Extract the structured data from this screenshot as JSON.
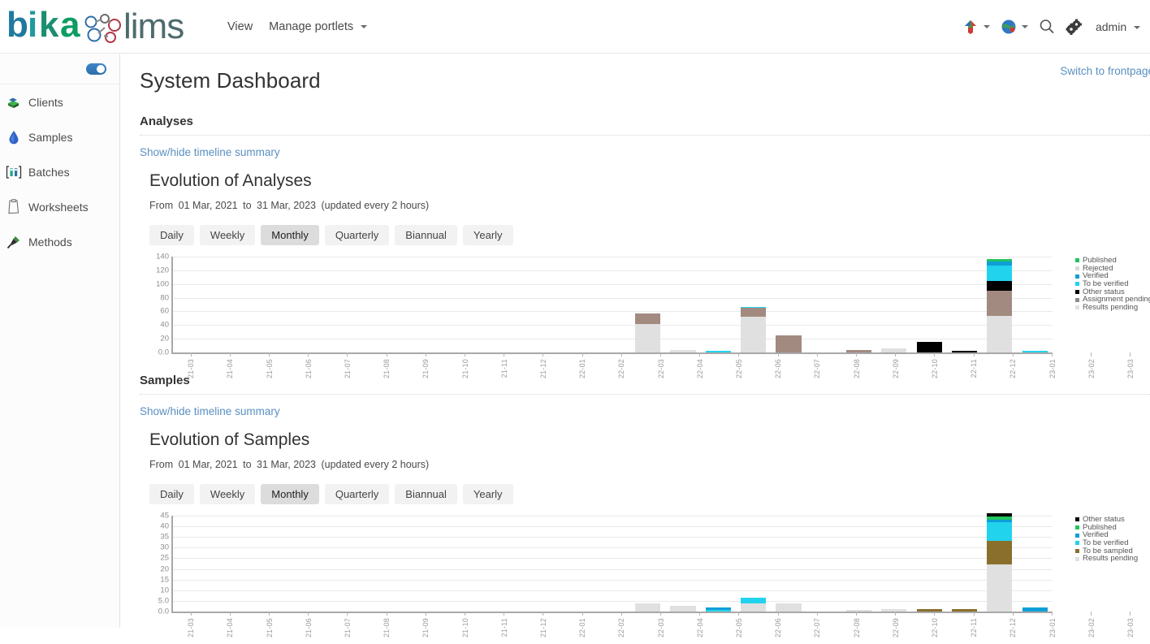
{
  "brand": {
    "name_part1": "bika",
    "name_part2": "lims"
  },
  "topnav": {
    "items": [
      {
        "label": "View",
        "has_caret": false
      },
      {
        "label": "Manage portlets",
        "has_caret": true
      }
    ],
    "icons": [
      "plone-logo-icon",
      "globe-language-icon",
      "search-icon",
      "gears-settings-icon"
    ],
    "user": "admin"
  },
  "sidebar": {
    "toggle_state": "on",
    "items": [
      {
        "label": "Clients",
        "icon": "clients-stack-icon"
      },
      {
        "label": "Samples",
        "icon": "water-drop-icon"
      },
      {
        "label": "Batches",
        "icon": "batches-bracket-icon"
      },
      {
        "label": "Worksheets",
        "icon": "clipboard-icon"
      },
      {
        "label": "Methods",
        "icon": "pin-method-icon"
      }
    ]
  },
  "page": {
    "title": "System Dashboard",
    "switch_link": "Switch to frontpage"
  },
  "sections": [
    {
      "heading": "Analyses",
      "showhide_label": "Show/hide timeline summary",
      "chart_title": "Evolution of Analyses",
      "range_prefix": "From",
      "range_from": "01 Mar, 2021",
      "range_mid": "to",
      "range_to": "31 Mar, 2023",
      "range_suffix": "(updated every 2 hours)",
      "periods": [
        "Daily",
        "Weekly",
        "Monthly",
        "Quarterly",
        "Biannual",
        "Yearly"
      ],
      "active_period": "Monthly"
    },
    {
      "heading": "Samples",
      "showhide_label": "Show/hide timeline summary",
      "chart_title": "Evolution of Samples",
      "range_prefix": "From",
      "range_from": "01 Mar, 2021",
      "range_mid": "to",
      "range_to": "31 Mar, 2023",
      "range_suffix": "(updated every 2 hours)",
      "periods": [
        "Daily",
        "Weekly",
        "Monthly",
        "Quarterly",
        "Biannual",
        "Yearly"
      ],
      "active_period": "Monthly"
    }
  ],
  "chart_data": [
    {
      "type": "bar",
      "stacked": true,
      "title": "Evolution of Analyses",
      "xlabel": "",
      "ylabel": "",
      "ylim": [
        0,
        140
      ],
      "yticks": [
        "140",
        "120",
        "100",
        "80",
        "60",
        "40",
        "20",
        "0.0"
      ],
      "ytick_values": [
        140,
        120,
        100,
        80,
        60,
        40,
        20,
        0
      ],
      "grid": true,
      "legend_position": "right",
      "categories": [
        "21-03",
        "21-04",
        "21-05",
        "21-06",
        "21-07",
        "21-08",
        "21-09",
        "21-10",
        "21-11",
        "21-12",
        "22-01",
        "22-02",
        "22-03",
        "22-04",
        "22-05",
        "22-06",
        "22-07",
        "22-08",
        "22-09",
        "22-10",
        "22-11",
        "22-12",
        "23-01",
        "23-02",
        "23-03"
      ],
      "series": [
        {
          "name": "Results pending",
          "color": "#e0e0e0",
          "values": [
            0,
            0,
            0,
            0,
            0,
            0,
            0,
            0,
            0,
            0,
            0,
            0,
            0,
            42,
            3,
            0,
            52,
            0,
            0,
            0,
            6,
            0,
            0,
            53,
            0
          ]
        },
        {
          "name": "Assignment pending",
          "color": "#a28a80",
          "values": [
            0,
            0,
            0,
            0,
            0,
            0,
            0,
            0,
            0,
            0,
            0,
            0,
            0,
            15,
            0,
            0,
            13,
            25,
            0,
            3,
            0,
            0,
            0,
            37,
            0
          ]
        },
        {
          "name": "Other status",
          "color": "#000000",
          "values": [
            0,
            0,
            0,
            0,
            0,
            0,
            0,
            0,
            0,
            0,
            0,
            0,
            0,
            0,
            0,
            0,
            0,
            0,
            0,
            0,
            0,
            15,
            2,
            15,
            0
          ]
        },
        {
          "name": "To be verified",
          "color": "#22d3ee",
          "values": [
            0,
            0,
            0,
            0,
            0,
            0,
            0,
            0,
            0,
            0,
            0,
            0,
            0,
            0,
            0,
            2,
            2,
            0,
            0,
            0,
            0,
            0,
            0,
            22,
            2
          ]
        },
        {
          "name": "Verified",
          "color": "#0e9fd8",
          "values": [
            0,
            0,
            0,
            0,
            0,
            0,
            0,
            0,
            0,
            0,
            0,
            0,
            0,
            0,
            0,
            0,
            0,
            0,
            0,
            0,
            0,
            0,
            0,
            6,
            0
          ]
        },
        {
          "name": "Published",
          "color": "#22c55e",
          "values": [
            0,
            0,
            0,
            0,
            0,
            0,
            0,
            0,
            0,
            0,
            0,
            0,
            0,
            0,
            0,
            0,
            0,
            0,
            0,
            0,
            0,
            0,
            0,
            3,
            0
          ]
        }
      ],
      "legend_order": [
        "Published",
        "Rejected",
        "Verified",
        "To be verified",
        "Other status",
        "Assignment pending",
        "Results pending"
      ],
      "legend_colors": {
        "Published": "#22c55e",
        "Rejected": "#d9d9d9",
        "Verified": "#0e9fd8",
        "To be verified": "#22d3ee",
        "Other status": "#000000",
        "Assignment pending": "#8c8c8c",
        "Results pending": "#e0e0e0"
      }
    },
    {
      "type": "bar",
      "stacked": true,
      "title": "Evolution of Samples",
      "xlabel": "",
      "ylabel": "",
      "ylim": [
        0,
        45
      ],
      "yticks": [
        "45",
        "40",
        "35",
        "30",
        "25",
        "20",
        "15",
        "10",
        "5.0",
        "0.0"
      ],
      "ytick_values": [
        45,
        40,
        35,
        30,
        25,
        20,
        15,
        10,
        5,
        0
      ],
      "grid": true,
      "legend_position": "right",
      "categories": [
        "21-03",
        "21-04",
        "21-05",
        "21-06",
        "21-07",
        "21-08",
        "21-09",
        "21-10",
        "21-11",
        "21-12",
        "22-01",
        "22-02",
        "22-03",
        "22-04",
        "22-05",
        "22-06",
        "22-07",
        "22-08",
        "22-09",
        "22-10",
        "22-11",
        "22-12",
        "23-01",
        "23-02",
        "23-03"
      ],
      "series": [
        {
          "name": "Results pending",
          "color": "#e0e0e0",
          "values": [
            0,
            0,
            0,
            0,
            0,
            0,
            0,
            0,
            0,
            0,
            0,
            0,
            0,
            4,
            2.5,
            0,
            4,
            4,
            0,
            0.8,
            1,
            0,
            0,
            22,
            0
          ]
        },
        {
          "name": "To be sampled",
          "color": "#8a6f2c",
          "values": [
            0,
            0,
            0,
            0,
            0,
            0,
            0,
            0,
            0,
            0,
            0,
            0,
            0,
            0,
            0,
            0,
            0,
            0,
            0,
            0,
            0,
            1.2,
            1,
            11,
            0
          ]
        },
        {
          "name": "To be verified",
          "color": "#22d3ee",
          "values": [
            0,
            0,
            0,
            0,
            0,
            0,
            0,
            0,
            0,
            0,
            0,
            0,
            0,
            0,
            0,
            0.6,
            2.5,
            0,
            0,
            0,
            0,
            0,
            0,
            9,
            0
          ]
        },
        {
          "name": "Verified",
          "color": "#0e9fd8",
          "values": [
            0,
            0,
            0,
            0,
            0,
            0,
            0,
            0,
            0,
            0,
            0,
            0,
            0,
            0,
            0,
            1.2,
            0,
            0,
            0,
            0,
            0,
            0,
            0,
            1,
            2
          ]
        },
        {
          "name": "Published",
          "color": "#22c55e",
          "values": [
            0,
            0,
            0,
            0,
            0,
            0,
            0,
            0,
            0,
            0,
            0,
            0,
            0,
            0,
            0,
            0,
            0,
            0,
            0,
            0,
            0,
            0,
            0,
            1.5,
            0
          ]
        },
        {
          "name": "Other status",
          "color": "#000000",
          "values": [
            0,
            0,
            0,
            0,
            0,
            0,
            0,
            0,
            0,
            0,
            0,
            0,
            0,
            0,
            0,
            0,
            0,
            0,
            0,
            0,
            0,
            0,
            0,
            1.5,
            0
          ]
        }
      ],
      "legend_order": [
        "Other status",
        "Published",
        "Verified",
        "To be verified",
        "To be sampled",
        "Results pending"
      ],
      "legend_colors": {
        "Other status": "#000000",
        "Published": "#22c55e",
        "Verified": "#0e9fd8",
        "To be verified": "#22d3ee",
        "To be sampled": "#8a6f2c",
        "Results pending": "#e0e0e0"
      }
    }
  ]
}
